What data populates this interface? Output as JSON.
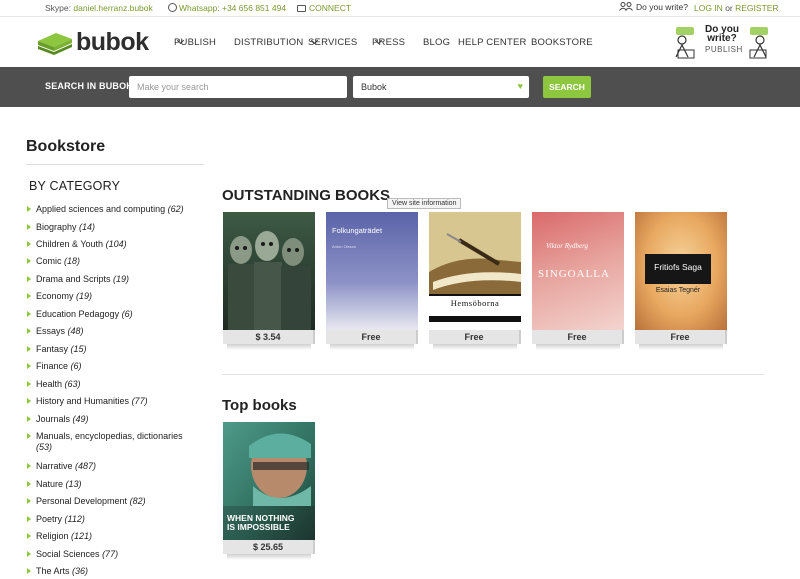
{
  "topbar": {
    "skype_label": "Skype:",
    "skype_value": "daniel.herranz.bubok",
    "whatsapp": "Whatsapp: +34 656 851 494",
    "connect": "CONNECT",
    "do_you_write": "Do you write?",
    "login": "LOG IN",
    "or": "or",
    "register": "REGISTER"
  },
  "header": {
    "logo_text": "bubok",
    "nav": [
      "PUBLISH",
      "DISTRIBUTION",
      "SERVICES",
      "PRESS",
      "BLOG",
      "HELP CENTER",
      "BOOKSTORE"
    ],
    "badge_line1": "Do you",
    "badge_line2": "write?",
    "badge_sub": "PUBLISH"
  },
  "search": {
    "label": "SEARCH IN BUBOK",
    "placeholder": "Make your search",
    "select_value": "Bubok",
    "button": "SEARCH"
  },
  "sidebar": {
    "title": "Bookstore",
    "category_title": "BY CATEGORY",
    "categories": [
      {
        "name": "Applied sciences and computing",
        "count": "(62)"
      },
      {
        "name": "Biography",
        "count": "(14)"
      },
      {
        "name": "Children & Youth",
        "count": "(104)"
      },
      {
        "name": "Comic",
        "count": "(18)"
      },
      {
        "name": "Drama and Scripts",
        "count": "(19)"
      },
      {
        "name": "Economy",
        "count": "(19)"
      },
      {
        "name": "Education Pedagogy",
        "count": "(6)"
      },
      {
        "name": "Essays",
        "count": "(48)"
      },
      {
        "name": "Fantasy",
        "count": "(15)"
      },
      {
        "name": "Finance",
        "count": "(6)"
      },
      {
        "name": "Health",
        "count": "(63)"
      },
      {
        "name": "History and Humanities",
        "count": "(77)"
      },
      {
        "name": "Journals",
        "count": "(49)"
      },
      {
        "name": "Manuals, encyclopedias, dictionaries",
        "count": "(53)"
      },
      {
        "name": "Narrative",
        "count": "(487)"
      },
      {
        "name": "Nature",
        "count": "(13)"
      },
      {
        "name": "Personal Development",
        "count": "(82)"
      },
      {
        "name": "Poetry",
        "count": "(112)"
      },
      {
        "name": "Religion",
        "count": "(121)"
      },
      {
        "name": "Social Sciences",
        "count": "(77)"
      },
      {
        "name": "The Arts",
        "count": "(36)"
      }
    ]
  },
  "main": {
    "outstanding_title": "OUTSTANDING BOOKS",
    "tooltip": "View site information",
    "outstanding": [
      {
        "price": "$ 3.54"
      },
      {
        "price": "Free",
        "cover_title": "Folkungaträdet",
        "cover_author": "Anton Olsson"
      },
      {
        "price": "Free",
        "cover_title": "Hemsöborna"
      },
      {
        "price": "Free",
        "cover_title": "SINGOALLA",
        "cover_author": "Viktor Rydberg"
      },
      {
        "price": "Free",
        "cover_title": "Fritiofs Saga",
        "cover_author": "Esaias Tegnér"
      }
    ],
    "top_title": "Top books",
    "top": [
      {
        "price": "$ 25.65",
        "cover_title": "WHEN NOTHING IS IMPOSSIBLE"
      }
    ]
  },
  "colors": {
    "accent_green": "#8dc63f",
    "link_green": "#7a9a2e",
    "search_bar": "#4f4f4f"
  }
}
